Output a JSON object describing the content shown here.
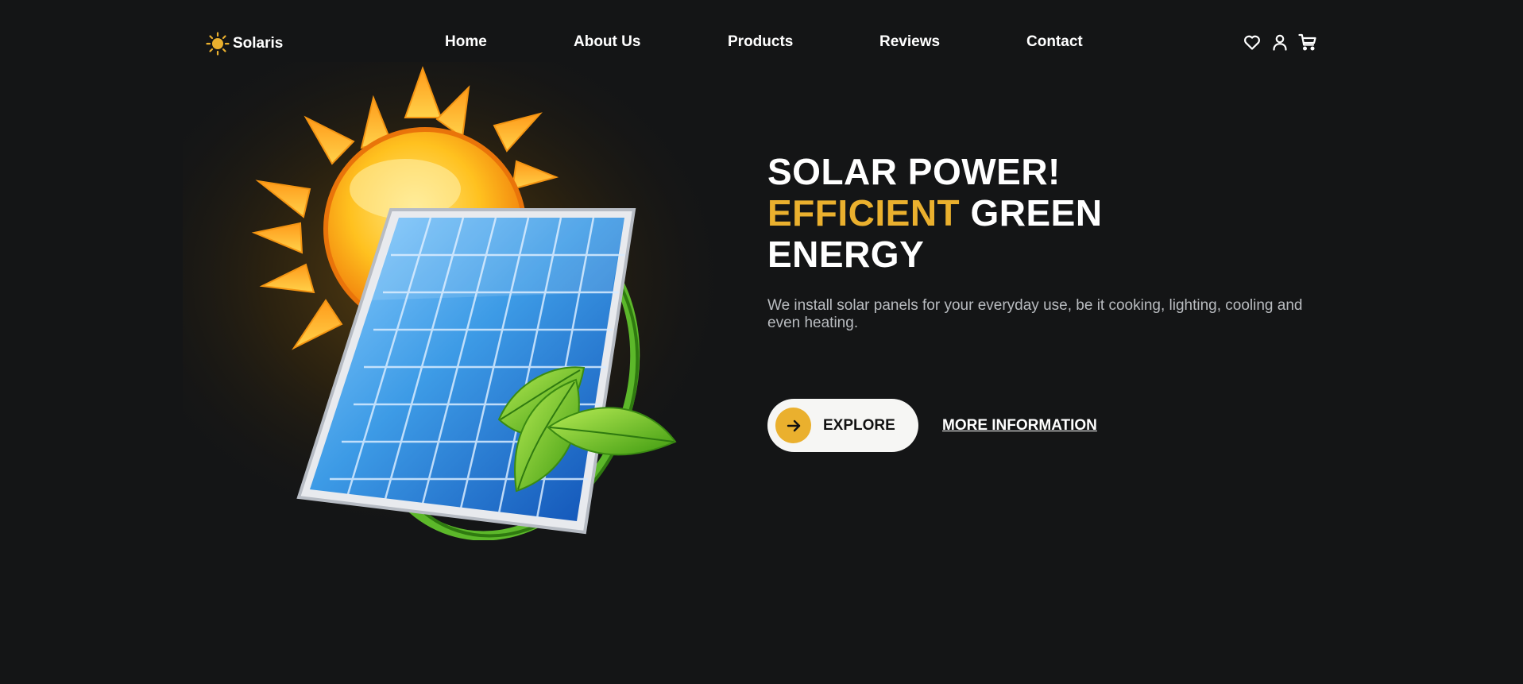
{
  "brand": {
    "name": "Solaris",
    "icon": "sun-icon",
    "accent_color": "#eab02e"
  },
  "nav": {
    "items": [
      {
        "label": "Home"
      },
      {
        "label": "About Us"
      },
      {
        "label": "Products"
      },
      {
        "label": "Reviews"
      },
      {
        "label": "Contact"
      }
    ]
  },
  "header_icons": [
    "heart-icon",
    "user-icon",
    "cart-icon"
  ],
  "hero": {
    "headline_line1": "SOLAR POWER!",
    "headline_accent": "EFFICIENT",
    "headline_line2_rest": " GREEN",
    "headline_line3": "ENERGY",
    "description": "We install solar panels for your everyday use, be it cooking, lighting, cooling and even heating.",
    "explore_label": "EXPLORE",
    "more_label": "MORE INFORMATION"
  },
  "colors": {
    "background": "#141516",
    "accent": "#eab02e",
    "text": "#ffffff",
    "muted_text": "#b9bcc0"
  }
}
